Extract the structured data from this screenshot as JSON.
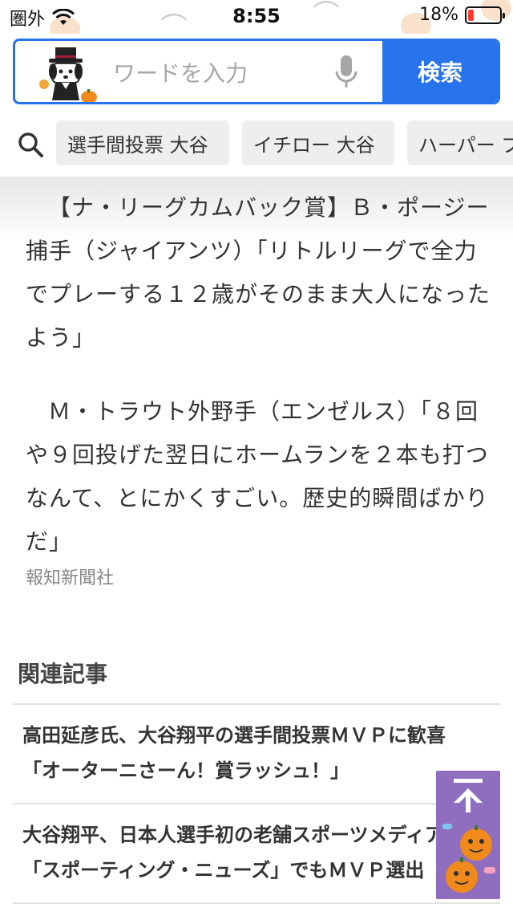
{
  "status_bar": {
    "carrier": "圏外",
    "time": "8:55",
    "battery": "18%",
    "battery_level": 0.18
  },
  "search": {
    "placeholder": "ワードを入力",
    "button_label": "検索"
  },
  "suggestions": [
    "選手間投票 大谷",
    "イチロー 大谷",
    "ハーパー ブ"
  ],
  "article": {
    "paragraphs": [
      "【ナ・リーグカムバック賞】Ｂ・ポージー捕手（ジャイアンツ）「リトルリーグで全力でプレーする１２歳がそのまま大人になったよう」",
      "Ｍ・トラウト外野手（エンゼルス）「８回や９回投げた翌日にホームランを２本も打つなんて、とにかくすごい。歴史的瞬間ばかりだ」"
    ],
    "source": "報知新聞社"
  },
  "related": {
    "title": "関連記事",
    "items": [
      {
        "line1": "高田延彦氏、大谷翔平の選手間投票ＭＶＰに歓喜",
        "line2": "「オーターニさーん！賞ラッシュ！」"
      },
      {
        "line1": "大谷翔平、日本人選手初の老舗スポーツメディア",
        "line2": "「スポーティング・ニューズ」でもＭＶＰ選出"
      }
    ]
  },
  "colors": {
    "accent": "#2673ec",
    "scroll_top_bg": "#8f6ec0",
    "battery_low": "#ff3b30"
  },
  "icons": [
    "wifi-icon",
    "battery-icon",
    "mascot-icon",
    "mic-icon",
    "search-icon",
    "arrow-up-icon",
    "pumpkin-icon"
  ]
}
